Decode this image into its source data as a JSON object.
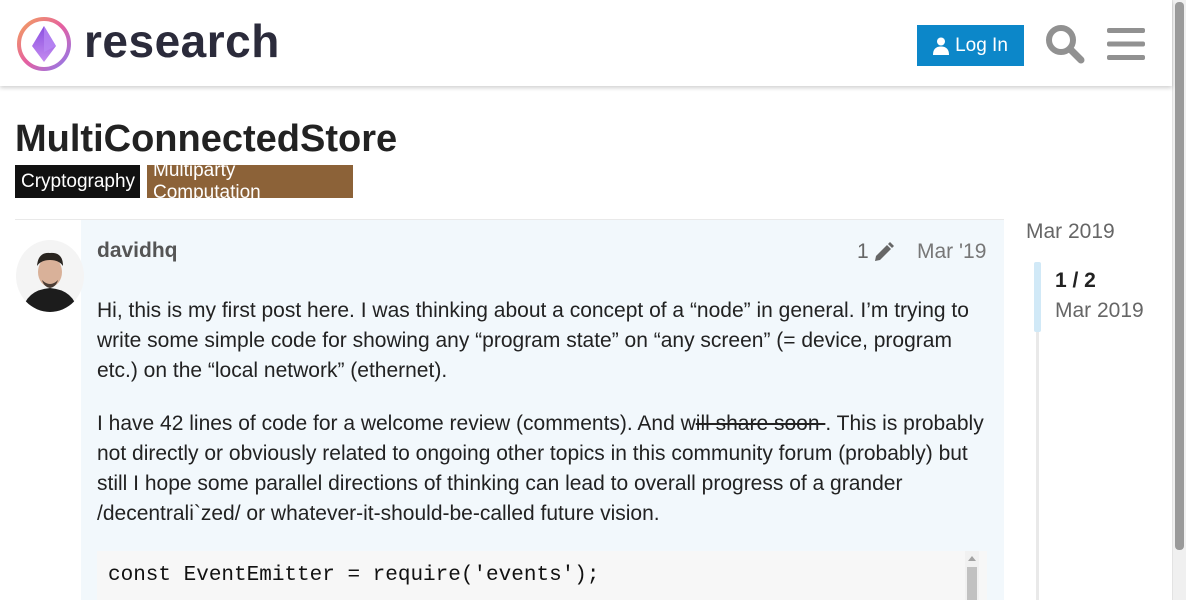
{
  "header": {
    "site_name": "research",
    "login_label": "Log In",
    "accent_color": "#0c87c9"
  },
  "topic": {
    "title": "MultiConnectedStore",
    "tags": [
      {
        "label": "Cryptography",
        "color": "#111111"
      },
      {
        "label": "Multiparty Computation",
        "color": "#8c6238"
      }
    ]
  },
  "post": {
    "username": "davidhq",
    "edit_count": "1",
    "date": "Mar '19",
    "paragraph1": "Hi, this is my first post here. I was thinking about a concept of a “node” in general. I’m trying to write some simple code for showing any “program state” on “any screen” (= device, program etc.) on the “local network” (ethernet).",
    "paragraph2_before": "I have 42 lines of code for a welcome review (comments). And w",
    "paragraph2_strike": "ill share soon ",
    "paragraph2_after": ". This is probably not directly or obviously related to ongoing other topics in this community forum (probably) but still I hope some parallel directions of thinking can lead to overall progress of a grander /decentrali`zed/ or whatever-it-should-be-called future vision.",
    "code_line": "const EventEmitter = require('events');"
  },
  "timeline": {
    "start_date": "Mar 2019",
    "position": "1 / 2",
    "current_date": "Mar 2019"
  },
  "icons": [
    "logo-icon",
    "user-icon",
    "search-icon",
    "hamburger-menu-icon",
    "pencil-icon"
  ]
}
